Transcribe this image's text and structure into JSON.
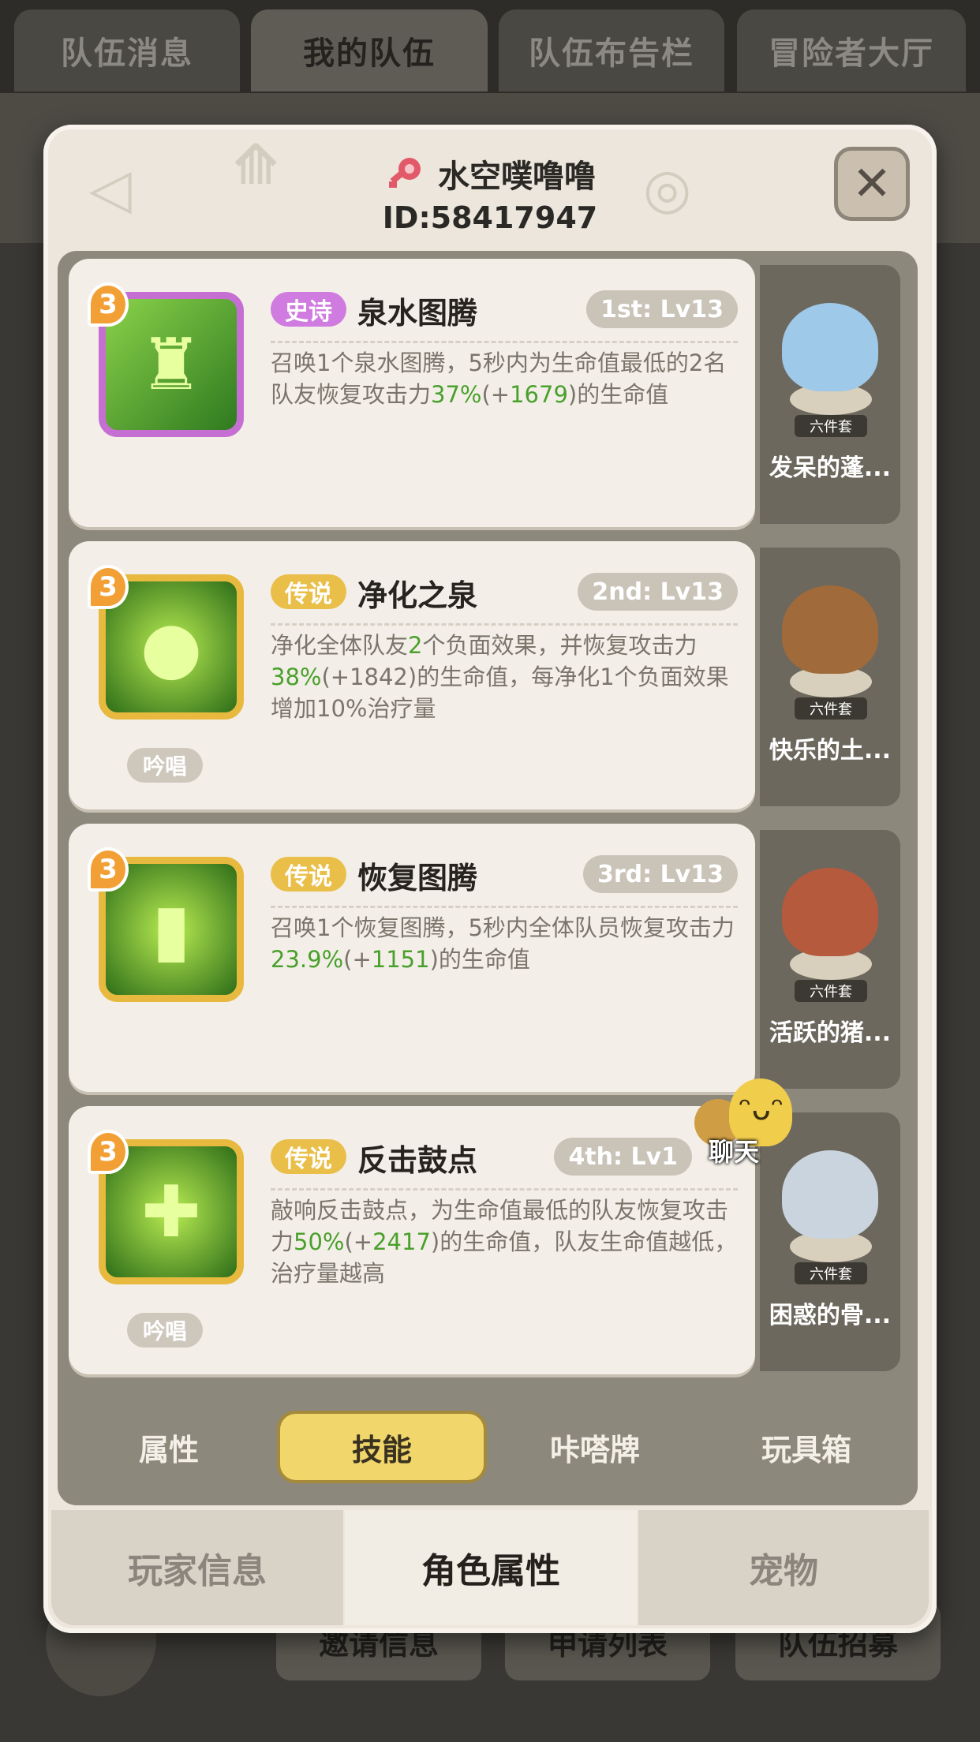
{
  "top_tabs": [
    "队伍消息",
    "我的队伍",
    "队伍布告栏",
    "冒险者大厅"
  ],
  "background_buttons": [
    "邀请信息",
    "申请列表",
    "队伍招募"
  ],
  "dialog": {
    "player_name": "水空噗噜噜",
    "player_id": "ID:58417947",
    "close_label": "✕"
  },
  "skills": [
    {
      "level": "3",
      "rarity": "史诗",
      "name": "泉水图腾",
      "slot": "1st: Lv13",
      "desc": [
        "召唤1个泉水图腾，5秒内为生命值最低的2名队友恢复攻击力",
        "37%",
        "(+",
        "1679",
        ")的生命值"
      ],
      "tag": "",
      "costume": {
        "set": "六件套",
        "name": "发呆的蓬..."
      }
    },
    {
      "level": "3",
      "rarity": "传说",
      "name": "净化之泉",
      "slot": "2nd: Lv13",
      "desc": [
        "净化全体队友",
        "2",
        "个负面效果，并恢复攻击力",
        "38%",
        "(+1842)的生命值，每净化1个负面效果增加10%治疗量"
      ],
      "tag": "吟唱",
      "costume": {
        "set": "六件套",
        "name": "快乐的土..."
      }
    },
    {
      "level": "3",
      "rarity": "传说",
      "name": "恢复图腾",
      "slot": "3rd: Lv13",
      "desc": [
        "召唤1个恢复图腾，5秒内全体队员恢复攻击力",
        "23.9%",
        "(+",
        "1151",
        ")的生命值"
      ],
      "tag": "",
      "costume": {
        "set": "六件套",
        "name": "活跃的猪..."
      }
    },
    {
      "level": "3",
      "rarity": "传说",
      "name": "反击鼓点",
      "slot": "4th: Lv1",
      "desc": [
        "敲响反击鼓点，为生命值最低的队友恢复攻击力",
        "50%",
        "(+",
        "2417",
        ")的生命值，队友生命值越低，治疗量越高"
      ],
      "tag": "吟唱",
      "costume": {
        "set": "六件套",
        "name": "困惑的骨..."
      }
    }
  ],
  "chat": {
    "label": "聊天"
  },
  "sub_tabs": [
    "属性",
    "技能",
    "咔嗒牌",
    "玩具箱"
  ],
  "sub_tab_active": "技能",
  "bottom_tabs": [
    "玩家信息",
    "角色属性",
    "宠物"
  ],
  "bottom_tab_active": "角色属性",
  "colors": {
    "epic": "#d07be0",
    "legend": "#e9bf4a",
    "highlight_green": "#4aa02c",
    "active_tab": "#f0d66b"
  }
}
